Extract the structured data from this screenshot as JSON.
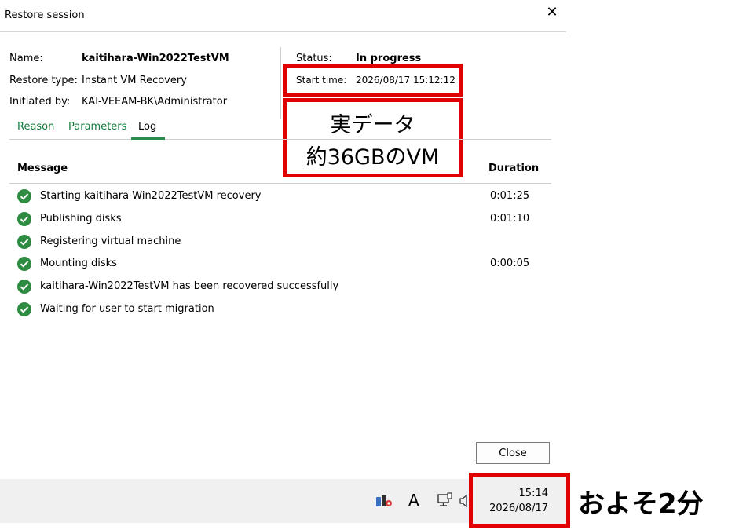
{
  "dialog": {
    "title": "Restore session"
  },
  "summary": {
    "name_label": "Name:",
    "name_value": "kaitihara-Win2022TestVM",
    "restore_type_label": "Restore type:",
    "restore_type_value": "Instant VM Recovery",
    "initiated_by_label": "Initiated by:",
    "initiated_by_value": "KAI-VEEAM-BK\\Administrator",
    "status_label": "Status:",
    "status_value": "In progress",
    "start_time_label": "Start time:",
    "start_time_value": "2026/08/17 15:12:12"
  },
  "tabs": [
    {
      "label": "Reason",
      "active": false
    },
    {
      "label": "Parameters",
      "active": false
    },
    {
      "label": "Log",
      "active": true
    }
  ],
  "log": {
    "columns": {
      "message": "Message",
      "duration": "Duration"
    },
    "rows": [
      {
        "message": "Starting kaitihara-Win2022TestVM recovery",
        "duration": "0:01:25",
        "status": "success"
      },
      {
        "message": "Publishing disks",
        "duration": "0:01:10",
        "status": "success"
      },
      {
        "message": "Registering virtual machine",
        "duration": "",
        "status": "success"
      },
      {
        "message": "Mounting disks",
        "duration": "0:00:05",
        "status": "success"
      },
      {
        "message": "kaitihara-Win2022TestVM has been recovered successfully",
        "duration": "",
        "status": "success"
      },
      {
        "message": "Waiting for user to start migration",
        "duration": "",
        "status": "success"
      }
    ]
  },
  "buttons": {
    "close_label": "Close"
  },
  "annotations": {
    "note_line1": "実データ",
    "note_line2": "約36GBのVM",
    "side_note": "およそ2分",
    "highlight_color": "#e00000"
  },
  "taskbar": {
    "ime_indicator": "A",
    "clock_time": "15:14",
    "clock_date": "2026/08/17",
    "icons": [
      "app-tray-icon",
      "network-icon",
      "volume-icon"
    ]
  },
  "colors": {
    "accent_green": "#127a3c",
    "success_icon": "#2e8b42"
  }
}
